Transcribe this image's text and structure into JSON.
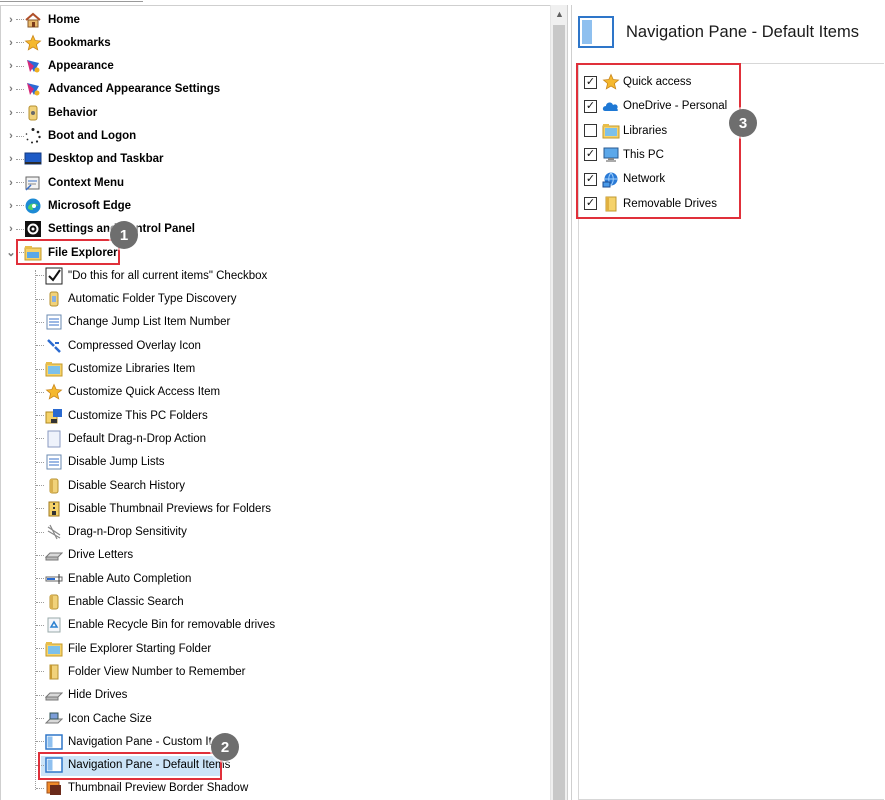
{
  "tree": {
    "top_items": [
      {
        "label": "Home",
        "icon": "home-icon"
      },
      {
        "label": "Bookmarks",
        "icon": "star-icon"
      },
      {
        "label": "Appearance",
        "icon": "palette-icon"
      },
      {
        "label": "Advanced Appearance Settings",
        "icon": "palette-icon"
      },
      {
        "label": "Behavior",
        "icon": "behavior-icon"
      },
      {
        "label": "Boot and Logon",
        "icon": "boot-icon"
      },
      {
        "label": "Desktop and Taskbar",
        "icon": "desktop-icon"
      },
      {
        "label": "Context Menu",
        "icon": "context-menu-icon"
      },
      {
        "label": "Microsoft Edge",
        "icon": "edge-icon"
      },
      {
        "label": "Settings and Control Panel",
        "icon": "gear-icon"
      },
      {
        "label": "File Explorer",
        "icon": "file-explorer-icon",
        "expanded": true
      }
    ],
    "children": [
      {
        "label": "\"Do this for all current items\" Checkbox",
        "icon": "checkmark-icon"
      },
      {
        "label": "Automatic Folder Type Discovery",
        "icon": "folder-type-icon"
      },
      {
        "label": "Change Jump List Item Number",
        "icon": "list-icon"
      },
      {
        "label": "Compressed Overlay Icon",
        "icon": "compressed-arrows-icon"
      },
      {
        "label": "Customize Libraries Item",
        "icon": "libraries-icon"
      },
      {
        "label": "Customize Quick Access Item",
        "icon": "star-icon"
      },
      {
        "label": "Customize This PC Folders",
        "icon": "pc-folder-icon"
      },
      {
        "label": "Default Drag-n-Drop Action",
        "icon": "page-icon"
      },
      {
        "label": "Disable Jump Lists",
        "icon": "list-icon"
      },
      {
        "label": "Disable Search History",
        "icon": "search-history-icon"
      },
      {
        "label": "Disable Thumbnail Previews for Folders",
        "icon": "zip-folder-icon"
      },
      {
        "label": "Drag-n-Drop Sensitivity",
        "icon": "sensitivity-icon"
      },
      {
        "label": "Drive Letters",
        "icon": "drive-icon"
      },
      {
        "label": "Enable Auto Completion",
        "icon": "autocomplete-icon"
      },
      {
        "label": "Enable Classic Search",
        "icon": "search-history-icon"
      },
      {
        "label": "Enable Recycle Bin for removable drives",
        "icon": "recycle-bin-icon"
      },
      {
        "label": "File Explorer Starting Folder",
        "icon": "libraries-icon"
      },
      {
        "label": "Folder View Number to Remember",
        "icon": "folder-view-icon"
      },
      {
        "label": "Hide Drives",
        "icon": "drive-icon"
      },
      {
        "label": "Icon Cache Size",
        "icon": "icon-cache-icon"
      },
      {
        "label": "Navigation Pane - Custom Items",
        "icon": "nav-pane-icon"
      },
      {
        "label": "Navigation Pane - Default Items",
        "icon": "nav-pane-icon",
        "selected": true
      },
      {
        "label": "Thumbnail Preview Border Shadow",
        "icon": "thumbnail-shadow-icon"
      }
    ]
  },
  "panel": {
    "title": "Navigation Pane - Default Items",
    "items": [
      {
        "label": "Quick access",
        "checked": true,
        "icon": "star-icon"
      },
      {
        "label": "OneDrive - Personal",
        "checked": true,
        "icon": "cloud-icon"
      },
      {
        "label": "Libraries",
        "checked": false,
        "icon": "libraries-icon"
      },
      {
        "label": "This PC",
        "checked": true,
        "icon": "pc-icon"
      },
      {
        "label": "Network",
        "checked": true,
        "icon": "network-icon"
      },
      {
        "label": "Removable Drives",
        "checked": true,
        "icon": "folder-icon"
      }
    ]
  },
  "annotations": {
    "badge1": "1",
    "badge2": "2",
    "badge3": "3",
    "highlight_color": "#e0303a"
  },
  "colors": {
    "selection": "#cce4f7",
    "accent": "#2e76c9"
  }
}
